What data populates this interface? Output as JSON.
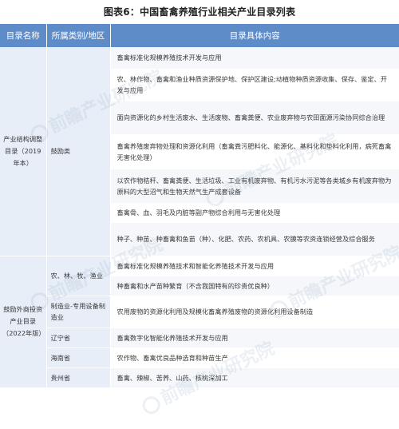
{
  "title": "图表6：中国畜禽养殖行业相关产业目录列表",
  "headers": [
    "目录名称",
    "所属类别/地区",
    "目录具体内容"
  ],
  "sections": [
    {
      "name": "产业结构调整目录（2019年本）",
      "groups": [
        {
          "category": "鼓励类",
          "items": [
            "畜禽标准化规模养殖技术开发与应用",
            "农、林作物、畜禽和渔业种质资源保护地、保护区建设;动植物种质资源收集、保存、鉴定、开发与应用",
            "面向资源化的乡村生活废水、生活废物、畜禽粪便、农业废弃物与农田面源污染协同综合治理",
            "畜禽养殖废弃物处理和资源化利用（畜禽粪污肥料化、能源化、基料化和垫料化利用，病死畜禽无害化处理）",
            "以农作物秸秆、畜禽粪便、生活垃圾、工业有机废弃物、有机污水污泥等各类城乡有机废弃物为原料的大型沼气和生物天然气生产成套设备",
            "畜禽骨、血、羽毛及内脏等副产物综合利用与无害化处理",
            "种子、种苗、种畜禽和鱼苗（种）、化肥、农药、农机具、农膜等农资连锁经营及综合服务"
          ]
        }
      ]
    },
    {
      "name": "鼓励外商投资产业目录（2022年版）",
      "groups": [
        {
          "category": "农、林、牧、渔业",
          "items": [
            "畜禽标准化规模养殖技术和智能化养殖技术开发与应用",
            "种畜禽和水产苗种繁育（不含我国特有的珍贵优良种）"
          ]
        },
        {
          "category": "制造业-专用设备制造业",
          "items": [
            "农用废物的资源化利用及规模化畜禽养殖废物的资源化利用设备制造"
          ]
        },
        {
          "category": "辽宁省",
          "items": [
            "畜禽数字化智能化养殖技术开发与应用"
          ]
        },
        {
          "category": "海南省",
          "items": [
            "农作物、畜禽优良品种选育和种苗生产"
          ]
        },
        {
          "category": "贵州省",
          "items": [
            "畜禽、辣椒、苦荞、山药、核桃深加工"
          ]
        }
      ]
    }
  ],
  "watermark_text": "前瞻产业研究院",
  "colors": {
    "header_bg": "#5e8cc9",
    "side_bg": "#e7eef8",
    "row_alt_bg": "#f5f7fb"
  }
}
